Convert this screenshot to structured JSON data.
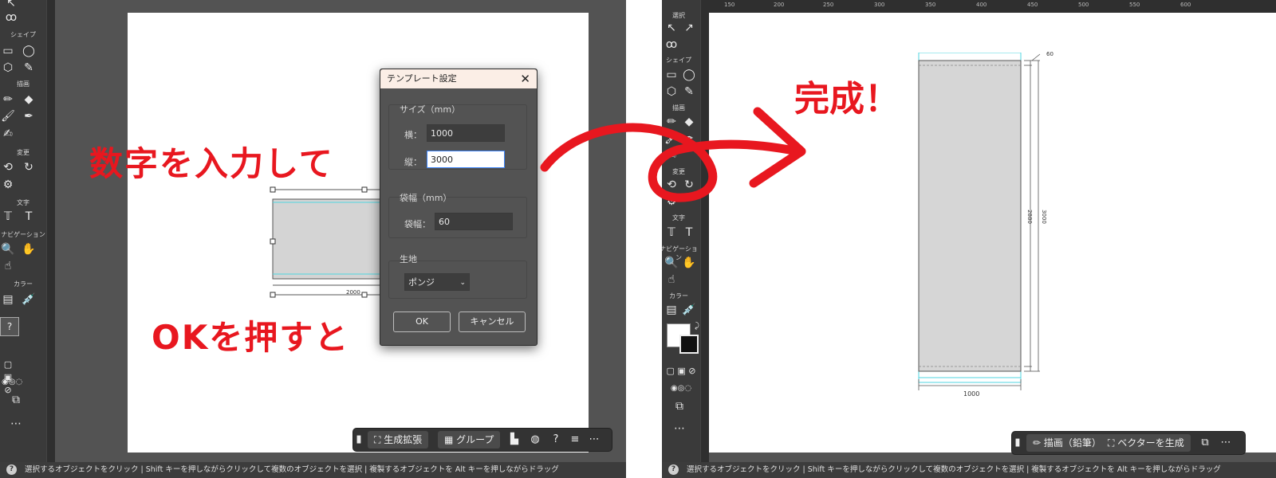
{
  "left": {
    "toolbar": {
      "sections": [
        "シェイプ",
        "描画",
        "変更",
        "文字",
        "ナビゲーション",
        "カラー"
      ]
    },
    "dialog": {
      "title": "テンプレート設定",
      "size_legend": "サイズ（mm）",
      "width_label": "横：",
      "width_value": "1000",
      "height_label": "縦：",
      "height_value": "3000",
      "bag_legend": "袋幅（mm）",
      "bag_label": "袋幅：",
      "bag_value": "60",
      "fabric_legend": "生地",
      "fabric_value": "ポンジ",
      "ok_label": "OK",
      "cancel_label": "キャンセル"
    },
    "preview_dim_label": "2000",
    "annotation_top": "数字を入力して",
    "annotation_bottom": "OKを押すと",
    "context_bar": {
      "generate_label": "生成拡張",
      "group_label": "グループ"
    }
  },
  "right": {
    "toolbar": {
      "sections": [
        "選択",
        "シェイプ",
        "描画",
        "変更",
        "文字",
        "ナビゲーション",
        "カラー"
      ]
    },
    "ruler_ticks": [
      "150",
      "200",
      "250",
      "300",
      "350",
      "400",
      "450",
      "500",
      "550",
      "600"
    ],
    "annotation": "完成！",
    "dims": {
      "bag": "60",
      "inner_height": "2880",
      "total_height": "3000",
      "width": "1000"
    },
    "context_bar": {
      "draw_label": "描画（鉛筆）",
      "vector_label": "ベクターを生成"
    }
  },
  "status_text": "選択するオブジェクトをクリック | Shift キーを押しながらクリックして複数のオブジェクトを選択 | 複製するオブジェクトを Alt キーを押しながらドラッグ",
  "colors": {
    "annotation": "#e8171f",
    "panel_bg": "#535353",
    "guide": "#4fd6e0"
  }
}
